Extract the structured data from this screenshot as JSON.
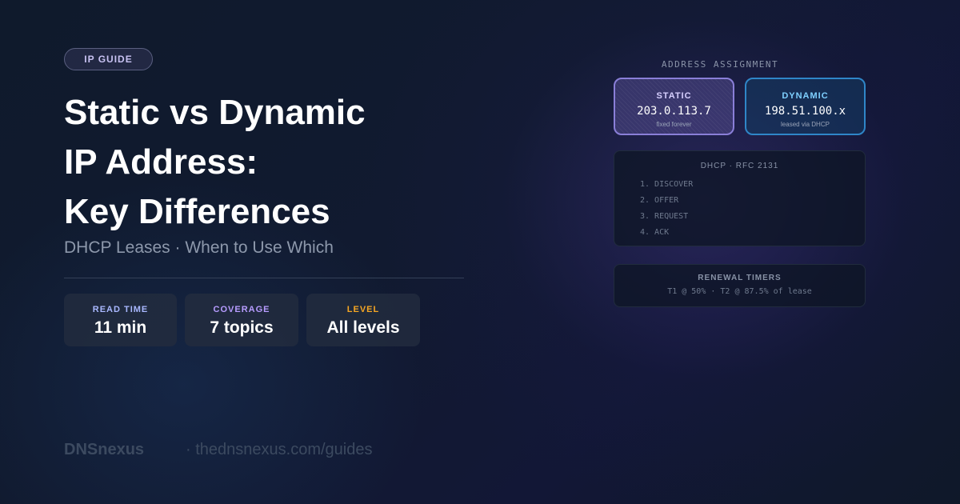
{
  "badge": "IP GUIDE",
  "title_lines": [
    "Static vs Dynamic",
    "IP Address:",
    "Key Differences"
  ],
  "subtitle": "DHCP Leases · When to Use Which",
  "stats": [
    {
      "label": "READ TIME",
      "value": "11 min",
      "color": "#a9b8ff"
    },
    {
      "label": "COVERAGE",
      "value": "7 topics",
      "color": "#b79cff"
    },
    {
      "label": "LEVEL",
      "value": "All levels",
      "color": "#f5a623"
    }
  ],
  "footer": {
    "brand": "DNSnexus",
    "url": "· thednsnexus.com/guides"
  },
  "diagram": {
    "title": "ADDRESS ASSIGNMENT",
    "static": {
      "label": "STATIC",
      "address": "203.0.113.7",
      "note": "fixed forever"
    },
    "dynamic": {
      "label": "DYNAMIC",
      "address": "198.51.100.x",
      "note": "leased via DHCP"
    },
    "dhcp": {
      "title": "DHCP · RFC 2131",
      "steps": [
        "1. DISCOVER",
        "2. OFFER",
        "3. REQUEST",
        "4. ACK"
      ]
    },
    "timers": {
      "title": "RENEWAL TIMERS",
      "text": "T1 @ 50% · T2 @ 87.5% of lease"
    }
  }
}
